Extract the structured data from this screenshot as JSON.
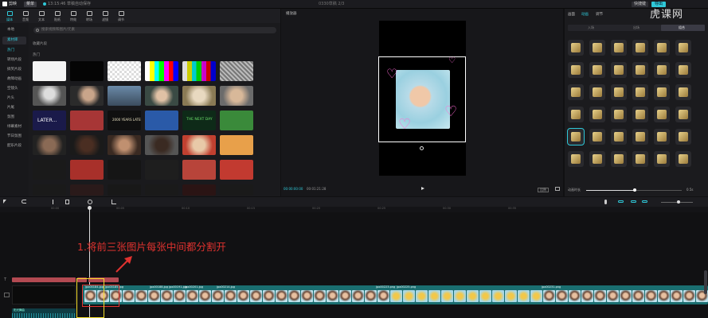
{
  "topbar": {
    "app_name": "剪映",
    "menu": "菜单",
    "autosave": "13:15:46 草稿自动保存",
    "project_name": "0330草稿 2/3",
    "shortcut_label": "快捷键",
    "export_label": "导出"
  },
  "toolbar": {
    "items": [
      "媒体",
      "音频",
      "文本",
      "贴纸",
      "特效",
      "转场",
      "滤镜",
      "调节"
    ]
  },
  "leftnav": {
    "items": [
      "本地",
      "素材库",
      "热门",
      "转场片段",
      "搞笑片段",
      "故障动画",
      "空镜头",
      "片头",
      "片尾",
      "氛围",
      "绿幕素材",
      "节日氛围",
      "配乐片段"
    ]
  },
  "media": {
    "search_placeholder": "搜索视频和图片/元素",
    "collected_label": "收藏片段",
    "hot_label": "热门"
  },
  "player": {
    "title": "播放器",
    "time_current": "00:00:00:00",
    "time_total": "00:01:21:28",
    "ratio_label": "比例"
  },
  "props": {
    "tabs": [
      "画面",
      "动画",
      "调节"
    ],
    "subtabs": [
      "入场",
      "出场",
      "组合"
    ],
    "duration_label": "动画时长",
    "duration_value": "0.5s",
    "watermark": "虎课网"
  },
  "timeline": {
    "ruler_ticks": [
      "00:00",
      "00:05",
      "00:10",
      "00:15",
      "00:20",
      "00:25",
      "00:30",
      "00:35"
    ],
    "annotation": "1.将前三张图片每张中间都分割开",
    "track_text_label": "T",
    "clip_labels": [
      "jpo00184.jpg",
      "jpo00185.jpg",
      "jpo00188.jpg",
      "jpo00191.jpg",
      "jpo00201.jpg",
      "jpo00214.jpg",
      "jpo00223.png",
      "jpo00225.png",
      "jpo00231.png"
    ],
    "audio_clip_label": "阳光舞曲"
  },
  "colors": {
    "accent": "#2fc8d8",
    "annotation_red": "#e0322f",
    "highlight_yellow": "#f2dc2a",
    "clip_teal": "#1a6e70",
    "text_clip": "#b34a52"
  }
}
